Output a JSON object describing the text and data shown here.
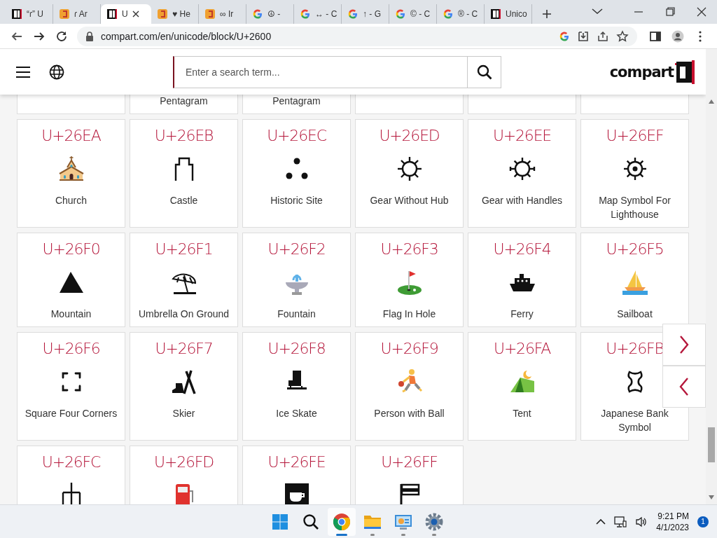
{
  "browser": {
    "tabs": [
      {
        "kind": "compart",
        "title": "“ɾ” U",
        "selected": false
      },
      {
        "kind": "orange",
        "title": "ɾ Ar",
        "selected": false
      },
      {
        "kind": "compart",
        "title": "U",
        "selected": true
      },
      {
        "kind": "orange",
        "title": "♥ He",
        "selected": false
      },
      {
        "kind": "orange",
        "title": "∞ Ir",
        "selected": false
      },
      {
        "kind": "google",
        "title": "☮ -",
        "selected": false
      },
      {
        "kind": "google",
        "title": "↔ - C",
        "selected": false
      },
      {
        "kind": "google",
        "title": "↑ - G",
        "selected": false
      },
      {
        "kind": "google",
        "title": "© - C",
        "selected": false
      },
      {
        "kind": "google",
        "title": "® - C",
        "selected": false
      },
      {
        "kind": "compart",
        "title": "Unico",
        "selected": false
      }
    ],
    "address": "compart.com/en/unicode/block/U+2600"
  },
  "header": {
    "search": {
      "placeholder": "Enter a search term..."
    },
    "logo": "compart"
  },
  "partial_cards": [
    {
      "kind": "blank"
    },
    {
      "kind": "named",
      "name": "Pentagram"
    },
    {
      "kind": "named",
      "name": "Pentagram"
    },
    {
      "kind": "blank"
    },
    {
      "kind": "blank"
    },
    {
      "kind": "blank"
    }
  ],
  "cards": [
    {
      "code": "U+26EA",
      "name": "Church"
    },
    {
      "code": "U+26EB",
      "name": "Castle"
    },
    {
      "code": "U+26EC",
      "name": "Historic Site"
    },
    {
      "code": "U+26ED",
      "name": "Gear Without Hub"
    },
    {
      "code": "U+26EE",
      "name": "Gear with Handles"
    },
    {
      "code": "U+26EF",
      "name": "Map Symbol For Lighthouse"
    },
    {
      "code": "U+26F0",
      "name": "Mountain"
    },
    {
      "code": "U+26F1",
      "name": "Umbrella On Ground"
    },
    {
      "code": "U+26F2",
      "name": "Fountain"
    },
    {
      "code": "U+26F3",
      "name": "Flag In Hole"
    },
    {
      "code": "U+26F4",
      "name": "Ferry"
    },
    {
      "code": "U+26F5",
      "name": "Sailboat"
    },
    {
      "code": "U+26F6",
      "name": "Square Four Corners"
    },
    {
      "code": "U+26F7",
      "name": "Skier"
    },
    {
      "code": "U+26F8",
      "name": "Ice Skate"
    },
    {
      "code": "U+26F9",
      "name": "Person with Ball"
    },
    {
      "code": "U+26FA",
      "name": "Tent"
    },
    {
      "code": "U+26FB",
      "name": "Japanese Bank Symbol"
    },
    {
      "code": "U+26FC"
    },
    {
      "code": "U+26FD"
    },
    {
      "code": "U+26FE"
    },
    {
      "code": "U+26FF"
    }
  ],
  "taskbar": {
    "apps": [
      {
        "kind": "start",
        "running": false,
        "selected": false
      },
      {
        "kind": "search",
        "running": false,
        "selected": false
      },
      {
        "kind": "chrome",
        "running": true,
        "selected": true
      },
      {
        "kind": "explorer",
        "running": true,
        "selected": false
      },
      {
        "kind": "control-panel",
        "running": true,
        "selected": false
      },
      {
        "kind": "settings",
        "running": true,
        "selected": false
      }
    ],
    "time": "9:21 PM",
    "date": "4/1/2023",
    "notifications": "1"
  }
}
